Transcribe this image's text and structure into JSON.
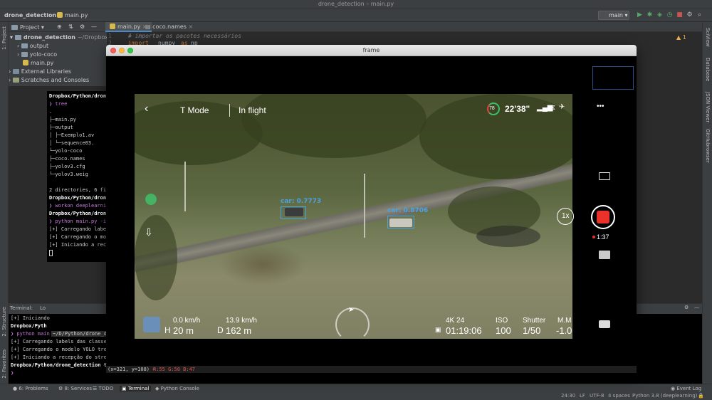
{
  "window": {
    "title": "drone_detection – main.py"
  },
  "navbar": {
    "project": "drone_detection",
    "file": "main.py",
    "run_config": "main"
  },
  "left_strip": {
    "project_label": "1: Project",
    "structure_label": "2: Structure",
    "favorites_label": "2: Favorites"
  },
  "right_strip": {
    "items": [
      "SciView",
      "Database",
      "JSON Viewer",
      "GitHubrowser"
    ]
  },
  "project_panel": {
    "header": "Project",
    "root_name": "drone_detection",
    "root_path": "~/Dropbox/P",
    "items": [
      "output",
      "yolo-coco",
      "main.py"
    ],
    "external": "External Libraries",
    "scratches": "Scratches and Consoles"
  },
  "editor": {
    "tabs": [
      "main.py",
      "coco.names"
    ],
    "lines": [
      {
        "num": "1",
        "text": "# importar os pacotes necessários"
      },
      {
        "num": "2",
        "text_kw": "import",
        "text_id": "numpy",
        "text_as": "as",
        "text_alias": "np"
      }
    ],
    "warning_count": "1"
  },
  "terminal_top": {
    "lines": [
      "Dropbox/Python/drone",
      "❯ tree",
      ".",
      "├─main.py",
      "├─output",
      "│  ├─Exemplo1.av",
      "│  └─sequence03.",
      "└─yolo-coco",
      "   ├─coco.names",
      "   ├─yolov3.cfg",
      "   └─yolov3.weig",
      "",
      "2 directories, 6 fi",
      "Dropbox/Python/drone",
      "❯ workon deeplearnin",
      "Dropbox/Python/drone",
      "❯ python main.py -i",
      "[+] Carregando labe",
      "[+] Carregando o mod",
      "[+] Iniciando a rece"
    ]
  },
  "terminal_panel": {
    "label": "Terminal:",
    "tab": "Lo",
    "lines": [
      "[+] Iniciando",
      "Dropbox/Pyth",
      "❯ python main",
      "[+] Carregando labels das classes",
      "[+] Carregando o modelo YOLO trei",
      "[+] Iniciando a recepção do strea",
      "Dropbox/Python/drone_detection to",
      "❯ "
    ],
    "path_tab": "~/D/Python/drone_de",
    "cursor_info": "(x=321, y=108) ~",
    "rgb_info": "R:55 G:58 B:47"
  },
  "tool_tabs": [
    "6: Problems",
    "8: Services",
    "TODO",
    "Terminal",
    "Python Console"
  ],
  "event_log": "Event Log",
  "status": {
    "position": "24:30",
    "line_sep": "LF",
    "encoding": "UTF-8",
    "indent": "4 spaces",
    "interpreter": "Python 3.8 (deeplearning)"
  },
  "frame": {
    "title": "frame",
    "hud": {
      "mode": "T Mode",
      "flight_state": "In flight",
      "battery": "78",
      "flight_time": "22'38\"",
      "speed_h": "0.0 km/h",
      "speed_v": "13.9 km/h",
      "height_label": "H",
      "height": "20 m",
      "distance_label": "D",
      "distance": "162 m",
      "res": "4K 24",
      "record_time": "01:19:06",
      "iso_label": "ISO",
      "iso": "100",
      "shutter_label": "Shutter",
      "shutter": "1/50",
      "mm_label": "M.M",
      "ev": "-1.0",
      "zoom": "1x",
      "rec_time": "1:37",
      "more": "•••"
    },
    "detections": [
      {
        "label": "car: 0.7773"
      },
      {
        "label": "car: 0.8706"
      }
    ]
  },
  "colors": {
    "detection": "#4aa3e0",
    "record": "#e8322a",
    "battery_ring": "#3fbf6a"
  }
}
